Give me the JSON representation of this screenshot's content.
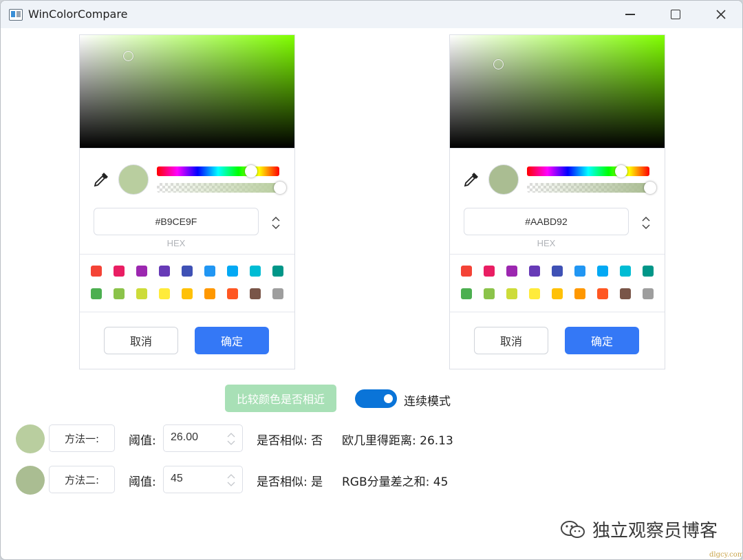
{
  "window": {
    "title": "WinColorCompare"
  },
  "pickers": [
    {
      "hex": "#B9CE9F",
      "hex_label": "HEX",
      "preview_color": "#B9CE9F",
      "cancel_label": "取消",
      "ok_label": "确定"
    },
    {
      "hex": "#AABD92",
      "hex_label": "HEX",
      "preview_color": "#AABD92",
      "cancel_label": "取消",
      "ok_label": "确定"
    }
  ],
  "palette": {
    "row1": [
      "#f44336",
      "#e91e63",
      "#9c27b0",
      "#673ab7",
      "#3f51b5",
      "#2196f3",
      "#03a9f4",
      "#00bcd4",
      "#009688"
    ],
    "row2": [
      "#4caf50",
      "#8bc34a",
      "#cddc39",
      "#ffeb3b",
      "#ffc107",
      "#ff9800",
      "#ff5722",
      "#795548",
      "#9e9e9e"
    ]
  },
  "controls": {
    "compare_button": "比较颜色是否相近",
    "continuous_mode_label": "连续模式",
    "continuous_mode_on": true
  },
  "method1": {
    "swatch_color": "#B9CE9F",
    "button": "方法一:",
    "threshold_label": "阈值:",
    "threshold": "26.00",
    "similar_label": "是否相似: 否",
    "result_label": "欧几里得距离: 26.13"
  },
  "method2": {
    "swatch_color": "#AABD92",
    "button": "方法二:",
    "threshold_label": "阈值:",
    "threshold": "45",
    "similar_label": "是否相似: 是",
    "result_label": "RGB分量差之和: 45"
  },
  "watermark": {
    "text": "独立观察员博客",
    "url": "dlgcy.com"
  }
}
